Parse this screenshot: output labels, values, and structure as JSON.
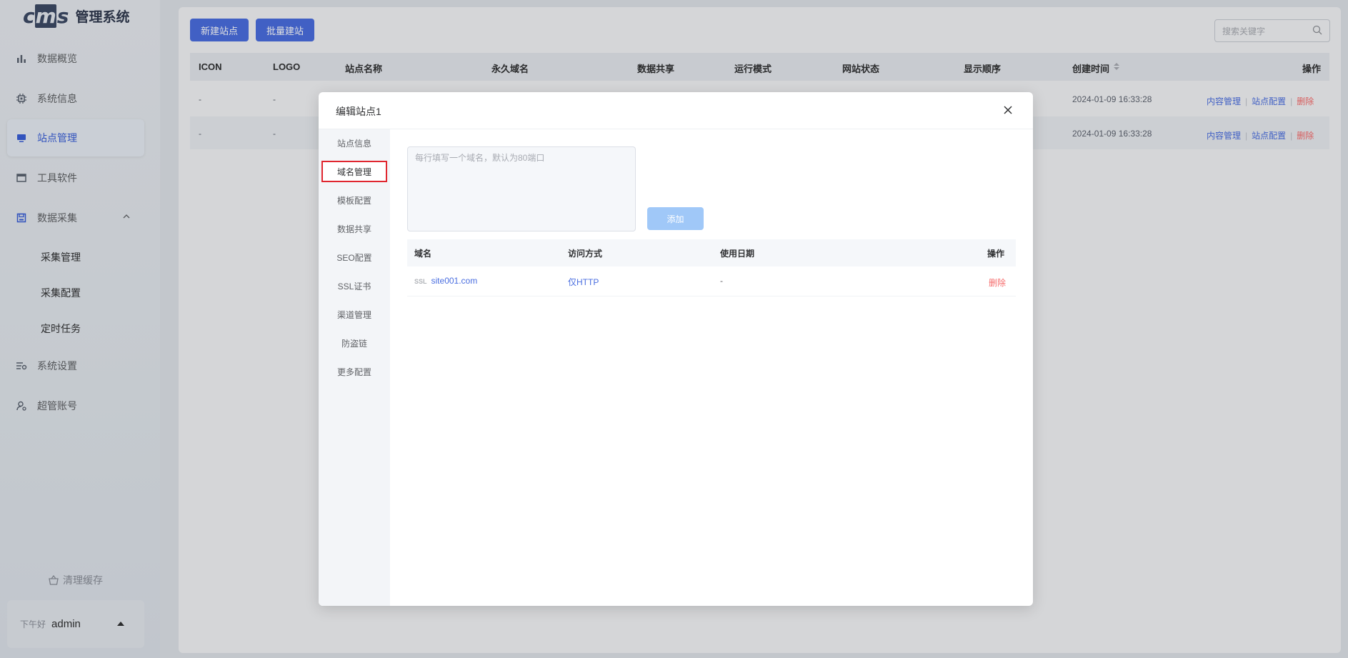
{
  "app": {
    "logo_text": "cms",
    "title": "管理系统"
  },
  "sidebar": {
    "items": [
      {
        "label": "数据概览",
        "icon": "bar-chart-icon"
      },
      {
        "label": "系统信息",
        "icon": "chip-icon"
      },
      {
        "label": "站点管理",
        "icon": "monitor-icon",
        "active": true
      },
      {
        "label": "工具软件",
        "icon": "window-icon"
      },
      {
        "label": "数据采集",
        "icon": "save-icon",
        "expanded": true
      },
      {
        "label": "系统设置",
        "icon": "settings-list-icon"
      },
      {
        "label": "超管账号",
        "icon": "user-gear-icon"
      }
    ],
    "sub_items": [
      "采集管理",
      "采集配置",
      "定时任务"
    ],
    "clear_cache": "清理缓存",
    "greeting": "下午好",
    "username": "admin"
  },
  "toolbar": {
    "new_site": "新建站点",
    "batch_site": "批量建站",
    "search_placeholder": "搜索关键字"
  },
  "table": {
    "headers": [
      "ICON",
      "LOGO",
      "站点名称",
      "永久域名",
      "数据共享",
      "运行模式",
      "网站状态",
      "显示顺序",
      "创建时间",
      "操作"
    ],
    "rows": [
      {
        "icon": "-",
        "logo": "-",
        "created": "2024-01-09 16:33:28"
      },
      {
        "icon": "-",
        "logo": "-",
        "created": "2024-01-09 16:33:28"
      }
    ],
    "actions": {
      "content": "内容管理",
      "config": "站点配置",
      "delete": "删除"
    }
  },
  "dialog": {
    "title": "编辑站点1",
    "tabs": [
      "站点信息",
      "域名管理",
      "模板配置",
      "数据共享",
      "SEO配置",
      "SSL证书",
      "渠道管理",
      "防盗链",
      "更多配置"
    ],
    "active_tab": 1,
    "textarea_placeholder": "每行填写一个域名，默认为80端口",
    "add_button": "添加",
    "domain_table": {
      "headers": [
        "域名",
        "访问方式",
        "使用日期",
        "操作"
      ],
      "rows": [
        {
          "ssl": "SSL",
          "domain": "site001.com",
          "access": "仅HTTP",
          "date": "-",
          "action": "删除"
        }
      ]
    }
  },
  "colors": {
    "primary": "#4a6ee0",
    "danger": "#f56c6c",
    "highlight": "#e0262f"
  }
}
